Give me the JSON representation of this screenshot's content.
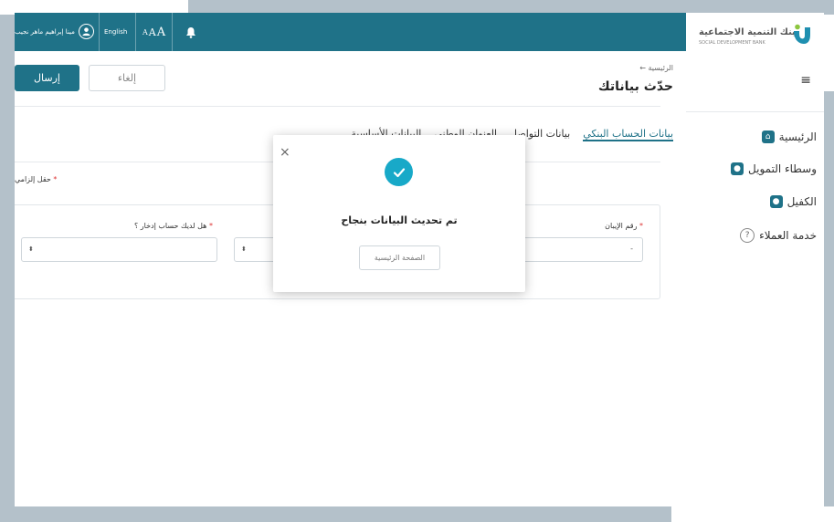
{
  "topbar": {
    "user_name": "مينا إبراهيم ماهر نجيب",
    "user_icon": "user-icon",
    "language": "English",
    "font_size_label_small": "A",
    "font_size_label_mid": "A",
    "font_size_label_big": "A",
    "bell_icon": "bell-icon",
    "background_color": "#1f7288"
  },
  "logo": {
    "name_ar": "بنك التنمية الاجتماعية",
    "name_en": "SOCIAL DEVELOPMENT BANK"
  },
  "sidebar": {
    "menu_icon": "hamburger-menu-icon",
    "items": [
      {
        "label": "الرئيسية",
        "icon": "home-icon"
      },
      {
        "label": "وسطاء التمويل",
        "icon": "user-icon"
      },
      {
        "label": "الكفيل",
        "icon": "user-icon"
      },
      {
        "label": "خدمة العملاء",
        "icon": "help-icon"
      }
    ]
  },
  "page": {
    "breadcrumb": "الرئيسية",
    "title": "حدّث بياناتك",
    "send_label": "إرسال",
    "cancel_label": "إلغاء",
    "tabs": [
      {
        "label": "البيانات الأساسية"
      },
      {
        "label": "العنوان الوطني"
      },
      {
        "label": "بيانات التواصل"
      },
      {
        "label": "بيانات الحساب البنكي"
      }
    ],
    "required_note": "حقل إلزامي",
    "required_star": "*",
    "fields": {
      "iban_label": "رقم الإيبان",
      "iban_value": "-",
      "savings_label": "هل لديك حساب إدخار ؟",
      "star": "*"
    }
  },
  "modal": {
    "close": "×",
    "message": "تم تحديث البيانات بنجاح",
    "home_button": "الصفحة الرئيسية",
    "check_icon": "check-circle-icon",
    "accent_color": "#18a9c8"
  }
}
